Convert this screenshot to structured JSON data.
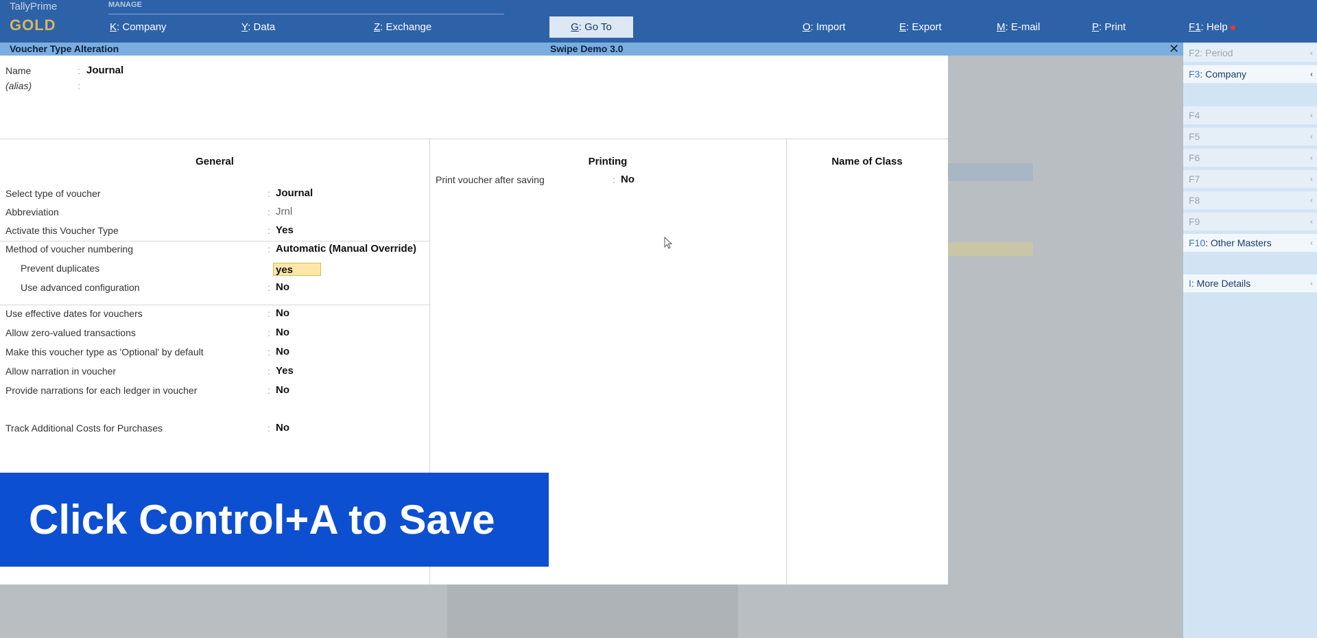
{
  "brand": {
    "product": "TallyPrime",
    "edition": "GOLD",
    "section": "MANAGE"
  },
  "toolbar": {
    "company": {
      "key": "K",
      "label": "Company"
    },
    "data": {
      "key": "Y",
      "label": "Data"
    },
    "exchange": {
      "key": "Z",
      "label": "Exchange"
    },
    "goto": {
      "key": "G",
      "label": "Go To"
    },
    "import": {
      "key": "O",
      "label": "Import"
    },
    "export": {
      "key": "E",
      "label": "Export"
    },
    "email": {
      "key": "M",
      "label": "E-mail"
    },
    "print": {
      "key": "P",
      "label": "Print"
    },
    "help": {
      "key": "F1",
      "label": "Help"
    }
  },
  "titlebar": {
    "title": "Voucher Type Alteration",
    "company": "Swipe Demo 3.0",
    "close": "✕"
  },
  "header": {
    "name_label": "Name",
    "name_value": "Journal",
    "alias_label": "(alias)",
    "alias_value": "",
    "colon": ":"
  },
  "general": {
    "heading": "General",
    "select_type_label": "Select type of voucher",
    "select_type_value": "Journal",
    "abbreviation_label": "Abbreviation",
    "abbreviation_value": "Jrnl",
    "activate_label": "Activate this Voucher Type",
    "activate_value": "Yes",
    "numbering_label": "Method of voucher numbering",
    "numbering_value": "Automatic (Manual Override)",
    "prevent_dup_label": "Prevent duplicates",
    "prevent_dup_value": "yes",
    "advanced_label": "Use advanced configuration",
    "advanced_value": "No",
    "effective_dates_label": "Use effective dates for vouchers",
    "effective_dates_value": "No",
    "zero_valued_label": "Allow zero-valued transactions",
    "zero_valued_value": "No",
    "optional_label": "Make this voucher type as 'Optional' by default",
    "optional_value": "No",
    "narration_label": "Allow narration in voucher",
    "narration_value": "Yes",
    "ledger_narration_label": "Provide narrations for each ledger in voucher",
    "ledger_narration_value": "No",
    "track_costs_label": "Track Additional Costs for Purchases",
    "track_costs_value": "No"
  },
  "printing": {
    "heading": "Printing",
    "print_after_label": "Print voucher after saving",
    "print_after_value": "No"
  },
  "class": {
    "heading": "Name of Class"
  },
  "caption": {
    "text": "Click Control+A to Save"
  },
  "sidebar": {
    "f2": {
      "key": "F2",
      "label": "Period"
    },
    "f3": {
      "key": "F3",
      "label": "Company"
    },
    "f4": {
      "key": "F4",
      "label": ""
    },
    "f5": {
      "key": "F5",
      "label": ""
    },
    "f6": {
      "key": "F6",
      "label": ""
    },
    "f7": {
      "key": "F7",
      "label": ""
    },
    "f8": {
      "key": "F8",
      "label": ""
    },
    "f9": {
      "key": "F9",
      "label": ""
    },
    "f10": {
      "key": "F10",
      "label": "Other Masters"
    },
    "more": {
      "key": "I",
      "label": "More Details"
    },
    "arrow": "‹"
  },
  "colors": {
    "topbar": "#2d62a8",
    "titlebar": "#7aaee0",
    "caption": "#0c4fd0",
    "edit_highlight": "#fde7a6",
    "sidebar": "#d2e4f4"
  }
}
